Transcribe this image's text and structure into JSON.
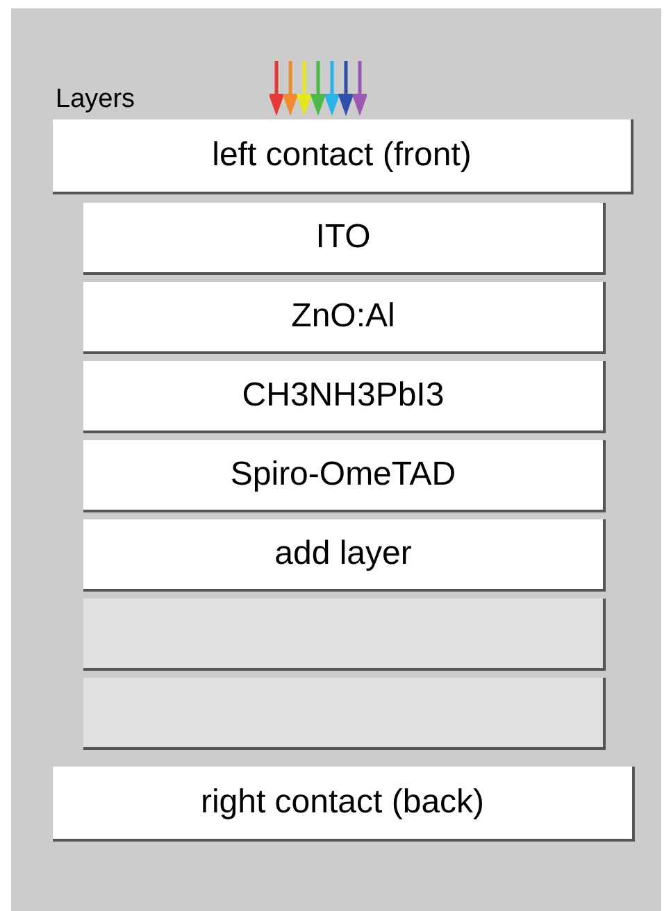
{
  "title": "Layers",
  "front_contact": {
    "label": "left contact (front)"
  },
  "layers": [
    {
      "label": "ITO",
      "disabled": false
    },
    {
      "label": "ZnO:Al",
      "disabled": false
    },
    {
      "label": "CH3NH3PbI3",
      "disabled": false
    },
    {
      "label": "Spiro-OmeTAD",
      "disabled": false
    },
    {
      "label": "add layer",
      "disabled": false
    },
    {
      "disabled": true
    },
    {
      "disabled": true
    }
  ],
  "back_contact": {
    "label": "right contact (back)"
  }
}
